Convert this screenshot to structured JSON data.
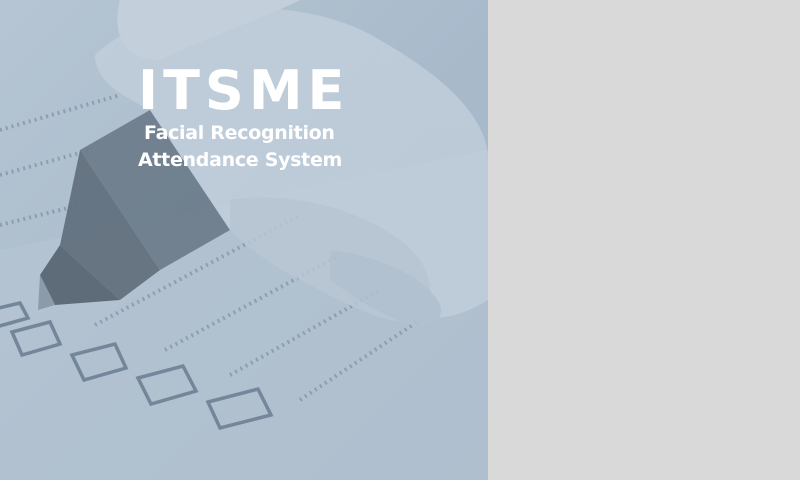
{
  "brand": {
    "logo": "ITSME",
    "tagline_line1": "Facial Recognition",
    "tagline_line2": "Attendance System"
  },
  "colors": {
    "hero_tint": "#aebfcd",
    "side_panel": "#d9d9d9",
    "text": "#ffffff"
  },
  "hero_image": {
    "icon": "hand-marking-checklist-illustration"
  }
}
